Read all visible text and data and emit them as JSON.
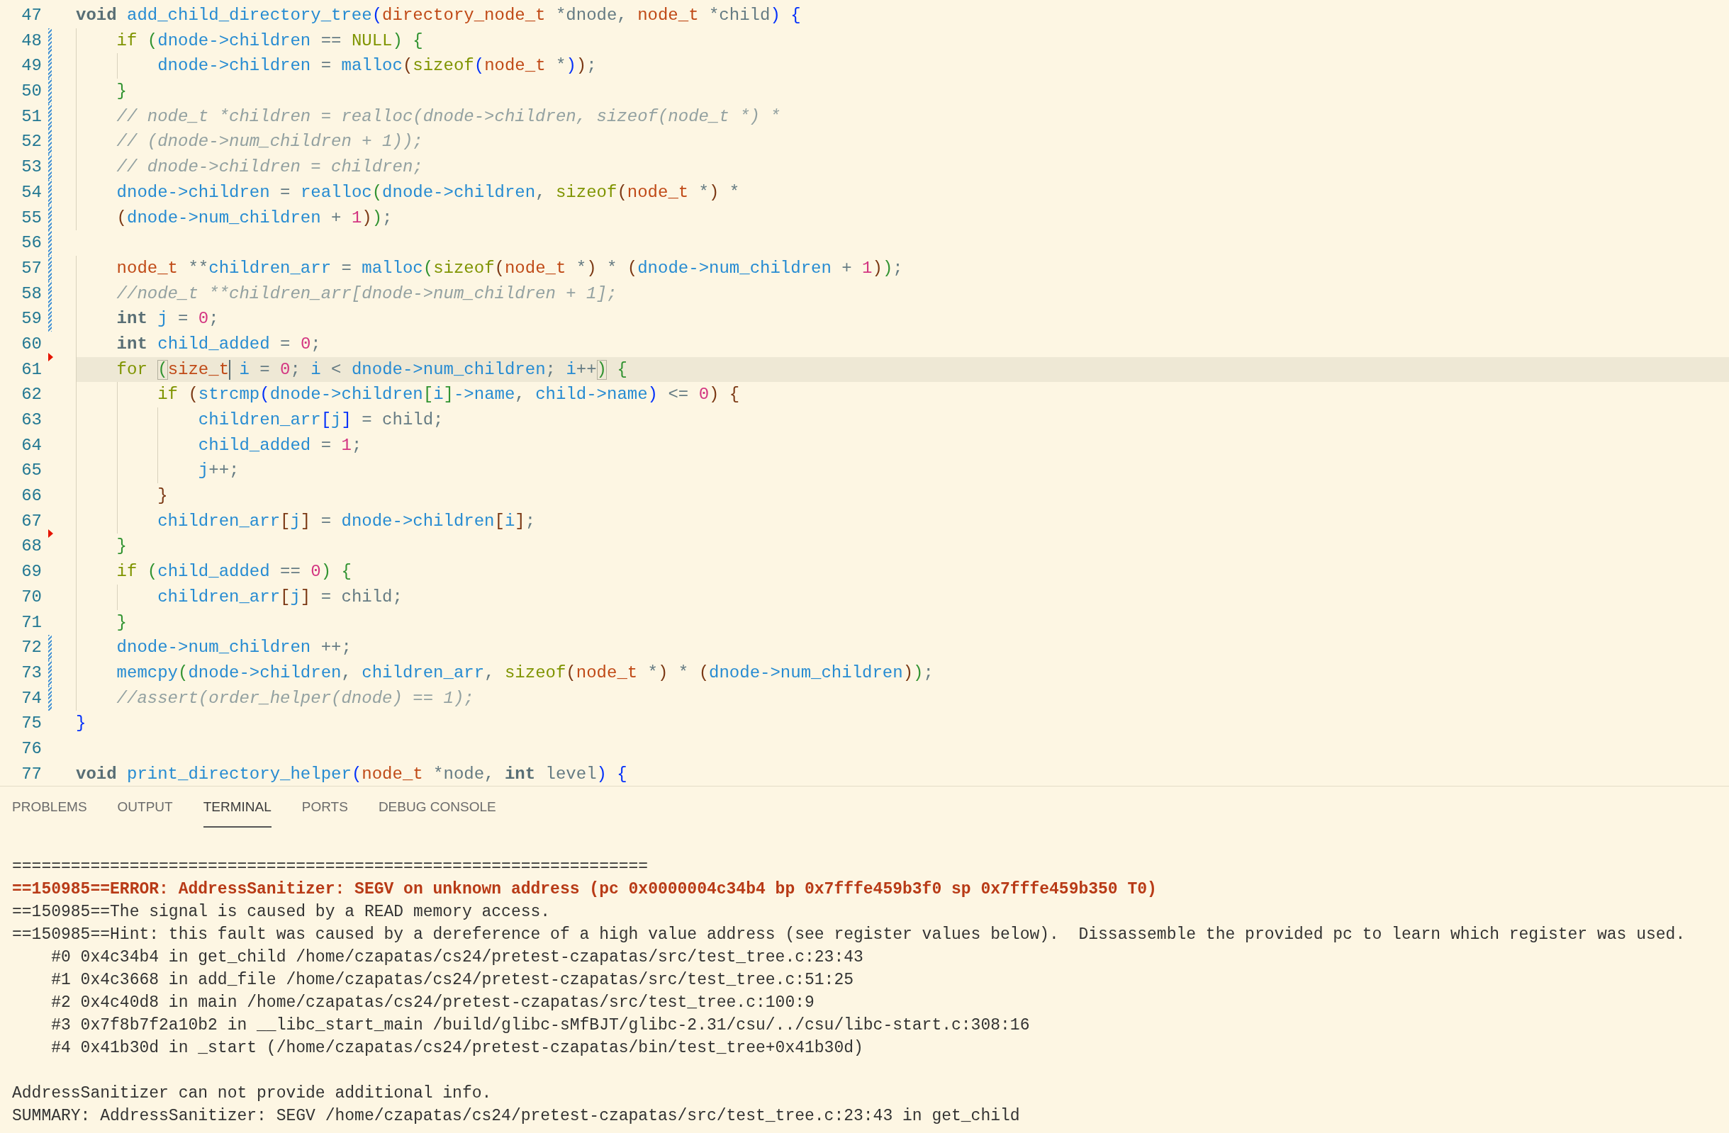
{
  "editor": {
    "lines": [
      {
        "number": "47",
        "modified": false,
        "deleted": false,
        "current": false,
        "tokens": [
          {
            "text": "void",
            "kind": "kw"
          },
          {
            "text": " add_child_directory_tree",
            "kind": "ident"
          },
          {
            "text": "(",
            "kind": "paren1"
          },
          {
            "text": "directory_node_t",
            "kind": "type"
          },
          {
            "text": " *dnode, ",
            "kind": "plain"
          },
          {
            "text": "node_t",
            "kind": "type"
          },
          {
            "text": " *child",
            "kind": "plain"
          },
          {
            "text": ")",
            "kind": "paren1"
          },
          {
            "text": " {",
            "kind": "paren1"
          }
        ]
      },
      {
        "number": "48",
        "modified": true,
        "deleted": false,
        "current": false,
        "tokens": [
          {
            "text": "    if",
            "kind": "ctrl"
          },
          {
            "text": " (",
            "kind": "paren2"
          },
          {
            "text": "dnode->children",
            "kind": "ident"
          },
          {
            "text": " == ",
            "kind": "plain"
          },
          {
            "text": "NULL",
            "kind": "ctrl"
          },
          {
            "text": ")",
            "kind": "paren2"
          },
          {
            "text": " {",
            "kind": "paren2"
          }
        ]
      },
      {
        "number": "49",
        "modified": true,
        "deleted": false,
        "current": false,
        "tokens": [
          {
            "text": "        dnode->children",
            "kind": "ident"
          },
          {
            "text": " = ",
            "kind": "plain"
          },
          {
            "text": "malloc",
            "kind": "ident"
          },
          {
            "text": "(",
            "kind": "paren3"
          },
          {
            "text": "sizeof",
            "kind": "ctrl"
          },
          {
            "text": "(",
            "kind": "paren1"
          },
          {
            "text": "node_t",
            "kind": "type"
          },
          {
            "text": " *",
            "kind": "plain"
          },
          {
            "text": ")",
            "kind": "paren1"
          },
          {
            "text": ")",
            "kind": "paren3"
          },
          {
            "text": ";",
            "kind": "plain"
          }
        ]
      },
      {
        "number": "50",
        "modified": true,
        "deleted": false,
        "current": false,
        "tokens": [
          {
            "text": "    }",
            "kind": "paren2"
          }
        ]
      },
      {
        "number": "51",
        "modified": true,
        "deleted": false,
        "current": false,
        "tokens": [
          {
            "text": "    // node_t *children = realloc(dnode->children, sizeof(node_t *) *",
            "kind": "comment"
          }
        ]
      },
      {
        "number": "52",
        "modified": true,
        "deleted": false,
        "current": false,
        "tokens": [
          {
            "text": "    // (dnode->num_children + 1));",
            "kind": "comment"
          }
        ]
      },
      {
        "number": "53",
        "modified": true,
        "deleted": false,
        "current": false,
        "tokens": [
          {
            "text": "    // dnode->children = children;",
            "kind": "comment"
          }
        ]
      },
      {
        "number": "54",
        "modified": true,
        "deleted": false,
        "current": false,
        "tokens": [
          {
            "text": "    dnode->children",
            "kind": "ident"
          },
          {
            "text": " = ",
            "kind": "plain"
          },
          {
            "text": "realloc",
            "kind": "ident"
          },
          {
            "text": "(",
            "kind": "paren2"
          },
          {
            "text": "dnode->children",
            "kind": "ident"
          },
          {
            "text": ", ",
            "kind": "plain"
          },
          {
            "text": "sizeof",
            "kind": "ctrl"
          },
          {
            "text": "(",
            "kind": "paren3"
          },
          {
            "text": "node_t",
            "kind": "type"
          },
          {
            "text": " *",
            "kind": "plain"
          },
          {
            "text": ")",
            "kind": "paren3"
          },
          {
            "text": " *",
            "kind": "plain"
          }
        ]
      },
      {
        "number": "55",
        "modified": true,
        "deleted": false,
        "current": false,
        "tokens": [
          {
            "text": "    (",
            "kind": "paren3"
          },
          {
            "text": "dnode->num_children",
            "kind": "ident"
          },
          {
            "text": " + ",
            "kind": "plain"
          },
          {
            "text": "1",
            "kind": "num"
          },
          {
            "text": ")",
            "kind": "paren3"
          },
          {
            "text": ")",
            "kind": "paren2"
          },
          {
            "text": ";",
            "kind": "plain"
          }
        ]
      },
      {
        "number": "56",
        "modified": true,
        "deleted": false,
        "current": false
      },
      {
        "number": "57",
        "modified": true,
        "deleted": false,
        "current": false,
        "tokens": [
          {
            "text": "    node_t",
            "kind": "type"
          },
          {
            "text": " **",
            "kind": "plain"
          },
          {
            "text": "children_arr",
            "kind": "ident"
          },
          {
            "text": " = ",
            "kind": "plain"
          },
          {
            "text": "malloc",
            "kind": "ident"
          },
          {
            "text": "(",
            "kind": "paren2"
          },
          {
            "text": "sizeof",
            "kind": "ctrl"
          },
          {
            "text": "(",
            "kind": "paren3"
          },
          {
            "text": "node_t",
            "kind": "type"
          },
          {
            "text": " *",
            "kind": "plain"
          },
          {
            "text": ")",
            "kind": "paren3"
          },
          {
            "text": " * ",
            "kind": "plain"
          },
          {
            "text": "(",
            "kind": "paren3"
          },
          {
            "text": "dnode->num_children",
            "kind": "ident"
          },
          {
            "text": " + ",
            "kind": "plain"
          },
          {
            "text": "1",
            "kind": "num"
          },
          {
            "text": ")",
            "kind": "paren3"
          },
          {
            "text": ")",
            "kind": "paren2"
          },
          {
            "text": ";",
            "kind": "plain"
          }
        ]
      },
      {
        "number": "58",
        "modified": true,
        "deleted": false,
        "current": false,
        "tokens": [
          {
            "text": "    //node_t **children_arr[dnode->num_children + 1];",
            "kind": "comment"
          }
        ]
      },
      {
        "number": "59",
        "modified": true,
        "deleted": false,
        "current": false,
        "tokens": [
          {
            "text": "    int",
            "kind": "kw"
          },
          {
            "text": " j",
            "kind": "ident"
          },
          {
            "text": " = ",
            "kind": "plain"
          },
          {
            "text": "0",
            "kind": "num"
          },
          {
            "text": ";",
            "kind": "plain"
          }
        ]
      },
      {
        "number": "60",
        "modified": false,
        "deleted": false,
        "current": false,
        "tokens": [
          {
            "text": "    int",
            "kind": "kw"
          },
          {
            "text": " child_added",
            "kind": "ident"
          },
          {
            "text": " = ",
            "kind": "plain"
          },
          {
            "text": "0",
            "kind": "num"
          },
          {
            "text": ";",
            "kind": "plain"
          }
        ]
      },
      {
        "number": "61",
        "modified": false,
        "deleted": true,
        "current": true,
        "tokens": [
          {
            "text": "    for ",
            "kind": "ctrl"
          },
          {
            "text": "(",
            "kind": "paren2",
            "matched": true
          },
          {
            "text": "size_t",
            "kind": "type",
            "cursor": true
          },
          {
            "text": " i",
            "kind": "ident"
          },
          {
            "text": " = ",
            "kind": "plain"
          },
          {
            "text": "0",
            "kind": "num"
          },
          {
            "text": "; ",
            "kind": "plain"
          },
          {
            "text": "i",
            "kind": "ident"
          },
          {
            "text": " < ",
            "kind": "plain"
          },
          {
            "text": "dnode->num_children",
            "kind": "ident"
          },
          {
            "text": "; ",
            "kind": "plain"
          },
          {
            "text": "i",
            "kind": "ident"
          },
          {
            "text": "++",
            "kind": "plain"
          },
          {
            "text": ")",
            "kind": "paren2",
            "matched": true
          },
          {
            "text": " {",
            "kind": "paren2"
          }
        ]
      },
      {
        "number": "62",
        "modified": false,
        "deleted": false,
        "current": false,
        "tokens": [
          {
            "text": "        if",
            "kind": "ctrl"
          },
          {
            "text": " (",
            "kind": "paren3"
          },
          {
            "text": "strcmp",
            "kind": "ident"
          },
          {
            "text": "(",
            "kind": "paren1"
          },
          {
            "text": "dnode->children",
            "kind": "ident"
          },
          {
            "text": "[",
            "kind": "paren2"
          },
          {
            "text": "i",
            "kind": "ident"
          },
          {
            "text": "]",
            "kind": "paren2"
          },
          {
            "text": "->name",
            "kind": "ident"
          },
          {
            "text": ", ",
            "kind": "plain"
          },
          {
            "text": "child->name",
            "kind": "ident"
          },
          {
            "text": ")",
            "kind": "paren1"
          },
          {
            "text": " <= ",
            "kind": "plain"
          },
          {
            "text": "0",
            "kind": "num"
          },
          {
            "text": ")",
            "kind": "paren3"
          },
          {
            "text": " {",
            "kind": "paren3"
          }
        ]
      },
      {
        "number": "63",
        "modified": false,
        "deleted": false,
        "current": false,
        "tokens": [
          {
            "text": "            children_arr",
            "kind": "ident"
          },
          {
            "text": "[",
            "kind": "paren1"
          },
          {
            "text": "j",
            "kind": "ident"
          },
          {
            "text": "]",
            "kind": "paren1"
          },
          {
            "text": " = child;",
            "kind": "plain"
          }
        ]
      },
      {
        "number": "64",
        "modified": false,
        "deleted": false,
        "current": false,
        "tokens": [
          {
            "text": "            child_added",
            "kind": "ident"
          },
          {
            "text": " = ",
            "kind": "plain"
          },
          {
            "text": "1",
            "kind": "num"
          },
          {
            "text": ";",
            "kind": "plain"
          }
        ]
      },
      {
        "number": "65",
        "modified": false,
        "deleted": false,
        "current": false,
        "tokens": [
          {
            "text": "            j",
            "kind": "ident"
          },
          {
            "text": "++;",
            "kind": "plain"
          }
        ]
      },
      {
        "number": "66",
        "modified": false,
        "deleted": false,
        "current": false,
        "tokens": [
          {
            "text": "        }",
            "kind": "paren3"
          }
        ]
      },
      {
        "number": "67",
        "modified": false,
        "deleted": false,
        "current": false,
        "tokens": [
          {
            "text": "        children_arr",
            "kind": "ident"
          },
          {
            "text": "[",
            "kind": "paren3"
          },
          {
            "text": "j",
            "kind": "ident"
          },
          {
            "text": "]",
            "kind": "paren3"
          },
          {
            "text": " = ",
            "kind": "plain"
          },
          {
            "text": "dnode->children",
            "kind": "ident"
          },
          {
            "text": "[",
            "kind": "paren3"
          },
          {
            "text": "i",
            "kind": "ident"
          },
          {
            "text": "]",
            "kind": "paren3"
          },
          {
            "text": ";",
            "kind": "plain"
          }
        ]
      },
      {
        "number": "68",
        "modified": false,
        "deleted": true,
        "current": false,
        "tokens": [
          {
            "text": "    }",
            "kind": "paren2"
          }
        ]
      },
      {
        "number": "69",
        "modified": false,
        "deleted": false,
        "current": false,
        "tokens": [
          {
            "text": "    if",
            "kind": "ctrl"
          },
          {
            "text": " (",
            "kind": "paren2"
          },
          {
            "text": "child_added",
            "kind": "ident"
          },
          {
            "text": " == ",
            "kind": "plain"
          },
          {
            "text": "0",
            "kind": "num"
          },
          {
            "text": ")",
            "kind": "paren2"
          },
          {
            "text": " {",
            "kind": "paren2"
          }
        ]
      },
      {
        "number": "70",
        "modified": false,
        "deleted": false,
        "current": false,
        "tokens": [
          {
            "text": "        children_arr",
            "kind": "ident"
          },
          {
            "text": "[",
            "kind": "paren3"
          },
          {
            "text": "j",
            "kind": "ident"
          },
          {
            "text": "]",
            "kind": "paren3"
          },
          {
            "text": " = child;",
            "kind": "plain"
          }
        ]
      },
      {
        "number": "71",
        "modified": false,
        "deleted": false,
        "current": false,
        "tokens": [
          {
            "text": "    }",
            "kind": "paren2"
          }
        ]
      },
      {
        "number": "72",
        "modified": true,
        "deleted": false,
        "current": false,
        "tokens": [
          {
            "text": "    dnode->num_children",
            "kind": "ident"
          },
          {
            "text": " ++;",
            "kind": "plain"
          }
        ]
      },
      {
        "number": "73",
        "modified": true,
        "deleted": false,
        "current": false,
        "tokens": [
          {
            "text": "    memcpy",
            "kind": "ident"
          },
          {
            "text": "(",
            "kind": "paren2"
          },
          {
            "text": "dnode->children",
            "kind": "ident"
          },
          {
            "text": ", ",
            "kind": "plain"
          },
          {
            "text": "children_arr",
            "kind": "ident"
          },
          {
            "text": ", ",
            "kind": "plain"
          },
          {
            "text": "sizeof",
            "kind": "ctrl"
          },
          {
            "text": "(",
            "kind": "paren3"
          },
          {
            "text": "node_t",
            "kind": "type"
          },
          {
            "text": " *",
            "kind": "plain"
          },
          {
            "text": ")",
            "kind": "paren3"
          },
          {
            "text": " * ",
            "kind": "plain"
          },
          {
            "text": "(",
            "kind": "paren3"
          },
          {
            "text": "dnode->num_children",
            "kind": "ident"
          },
          {
            "text": ")",
            "kind": "paren3"
          },
          {
            "text": ")",
            "kind": "paren2"
          },
          {
            "text": ";",
            "kind": "plain"
          }
        ]
      },
      {
        "number": "74",
        "modified": true,
        "deleted": false,
        "current": false,
        "tokens": [
          {
            "text": "    //assert(order_helper(dnode) == 1);",
            "kind": "comment"
          }
        ]
      },
      {
        "number": "75",
        "modified": false,
        "deleted": false,
        "current": false,
        "tokens": [
          {
            "text": "}",
            "kind": "paren1"
          }
        ]
      },
      {
        "number": "76",
        "modified": false,
        "deleted": false,
        "current": false
      },
      {
        "number": "77",
        "modified": false,
        "deleted": false,
        "current": false,
        "tokens": [
          {
            "text": "void",
            "kind": "kw"
          },
          {
            "text": " print_directory_helper",
            "kind": "ident"
          },
          {
            "text": "(",
            "kind": "paren1"
          },
          {
            "text": "node_t",
            "kind": "type"
          },
          {
            "text": " *node, ",
            "kind": "plain"
          },
          {
            "text": "int",
            "kind": "kw"
          },
          {
            "text": " level",
            "kind": "plain"
          },
          {
            "text": ")",
            "kind": "paren1"
          },
          {
            "text": " {",
            "kind": "paren1"
          }
        ]
      }
    ]
  },
  "panel": {
    "tabs": [
      {
        "label": "PROBLEMS",
        "selected": false
      },
      {
        "label": "OUTPUT",
        "selected": false
      },
      {
        "label": "TERMINAL",
        "selected": true
      },
      {
        "label": "PORTS",
        "selected": false
      },
      {
        "label": "DEBUG CONSOLE",
        "selected": false
      }
    ]
  },
  "terminal": {
    "blocks": [
      {
        "lines": [
          {
            "kind": "normal",
            "text": "================================================================="
          },
          {
            "kind": "error",
            "text": "==150985==ERROR: AddressSanitizer: SEGV on unknown address (pc 0x0000004c34b4 bp 0x7fffe459b3f0 sp 0x7fffe459b350 T0)"
          },
          {
            "kind": "normal",
            "text": "==150985==The signal is caused by a READ memory access."
          },
          {
            "kind": "normal",
            "text": "==150985==Hint: this fault was caused by a dereference of a high value address (see register values below).  Dissassemble the provided pc to learn which register was used."
          },
          {
            "kind": "normal",
            "text": "    #0 0x4c34b4 in get_child /home/czapatas/cs24/pretest-czapatas/src/test_tree.c:23:43"
          },
          {
            "kind": "normal",
            "text": "    #1 0x4c3668 in add_file /home/czapatas/cs24/pretest-czapatas/src/test_tree.c:51:25"
          },
          {
            "kind": "normal",
            "text": "    #2 0x4c40d8 in main /home/czapatas/cs24/pretest-czapatas/src/test_tree.c:100:9"
          },
          {
            "kind": "normal",
            "text": "    #3 0x7f8b7f2a10b2 in __libc_start_main /build/glibc-sMfBJT/glibc-2.31/csu/../csu/libc-start.c:308:16"
          },
          {
            "kind": "normal",
            "text": "    #4 0x41b30d in _start (/home/czapatas/cs24/pretest-czapatas/bin/test_tree+0x41b30d)"
          }
        ]
      },
      {
        "lines": [
          {
            "kind": "normal",
            "text": "AddressSanitizer can not provide additional info."
          },
          {
            "kind": "normal",
            "text": "SUMMARY: AddressSanitizer: SEGV /home/czapatas/cs24/pretest-czapatas/src/test_tree.c:23:43 in get_child"
          }
        ]
      }
    ]
  }
}
